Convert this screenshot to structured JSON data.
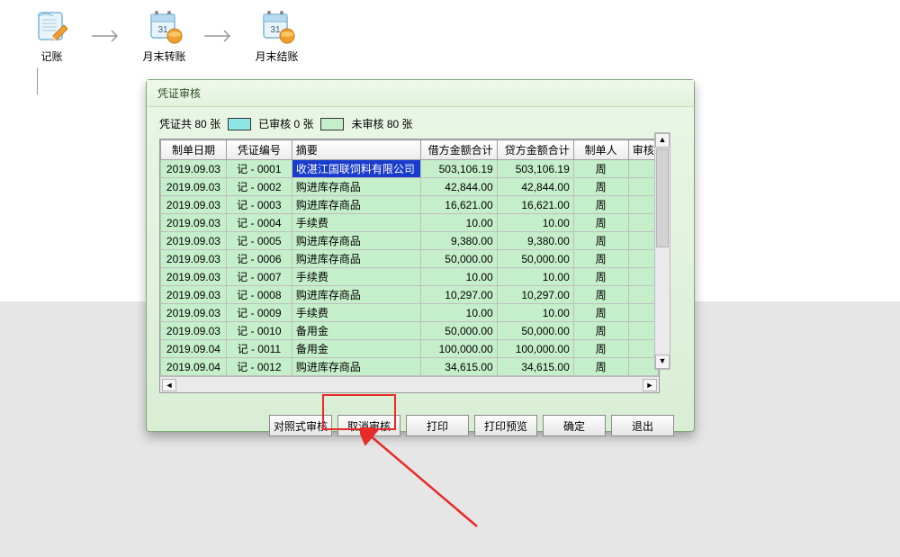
{
  "toolbar": {
    "items": [
      {
        "label": "记账"
      },
      {
        "label": "月末转账"
      },
      {
        "label": "月末结账"
      }
    ]
  },
  "window": {
    "title": "凭证审核",
    "summary": {
      "total_prefix": "凭证共",
      "total_count": "80",
      "total_suffix": "张",
      "approved_label": "已审核",
      "approved_count": "0",
      "approved_suffix": "张",
      "pending_label": "未审核",
      "pending_count": "80",
      "pending_suffix": "张"
    },
    "columns": [
      "制单日期",
      "凭证编号",
      "摘要",
      "借方金额合计",
      "贷方金额合计",
      "制单人",
      "审核"
    ],
    "rows": [
      {
        "date": "2019.09.03",
        "num": "记 - 0001",
        "summ": "收湛江国联饲料有限公司",
        "debit": "503,106.19",
        "credit": "503,106.19",
        "maker": "周",
        "sel": true
      },
      {
        "date": "2019.09.03",
        "num": "记 - 0002",
        "summ": "购进库存商品",
        "debit": "42,844.00",
        "credit": "42,844.00",
        "maker": "周"
      },
      {
        "date": "2019.09.03",
        "num": "记 - 0003",
        "summ": "购进库存商品",
        "debit": "16,621.00",
        "credit": "16,621.00",
        "maker": "周"
      },
      {
        "date": "2019.09.03",
        "num": "记 - 0004",
        "summ": "手续费",
        "debit": "10.00",
        "credit": "10.00",
        "maker": "周"
      },
      {
        "date": "2019.09.03",
        "num": "记 - 0005",
        "summ": "购进库存商品",
        "debit": "9,380.00",
        "credit": "9,380.00",
        "maker": "周"
      },
      {
        "date": "2019.09.03",
        "num": "记 - 0006",
        "summ": "购进库存商品",
        "debit": "50,000.00",
        "credit": "50,000.00",
        "maker": "周"
      },
      {
        "date": "2019.09.03",
        "num": "记 - 0007",
        "summ": "手续费",
        "debit": "10.00",
        "credit": "10.00",
        "maker": "周"
      },
      {
        "date": "2019.09.03",
        "num": "记 - 0008",
        "summ": "购进库存商品",
        "debit": "10,297.00",
        "credit": "10,297.00",
        "maker": "周"
      },
      {
        "date": "2019.09.03",
        "num": "记 - 0009",
        "summ": "手续费",
        "debit": "10.00",
        "credit": "10.00",
        "maker": "周"
      },
      {
        "date": "2019.09.03",
        "num": "记 - 0010",
        "summ": "备用金",
        "debit": "50,000.00",
        "credit": "50,000.00",
        "maker": "周"
      },
      {
        "date": "2019.09.04",
        "num": "记 - 0011",
        "summ": "备用金",
        "debit": "100,000.00",
        "credit": "100,000.00",
        "maker": "周"
      },
      {
        "date": "2019.09.04",
        "num": "记 - 0012",
        "summ": "购进库存商品",
        "debit": "34,615.00",
        "credit": "34,615.00",
        "maker": "周"
      }
    ],
    "buttons": {
      "compare": "对照式审核",
      "cancel": "取消审核",
      "print": "打印",
      "preview": "打印预览",
      "ok": "确定",
      "exit": "退出"
    }
  }
}
